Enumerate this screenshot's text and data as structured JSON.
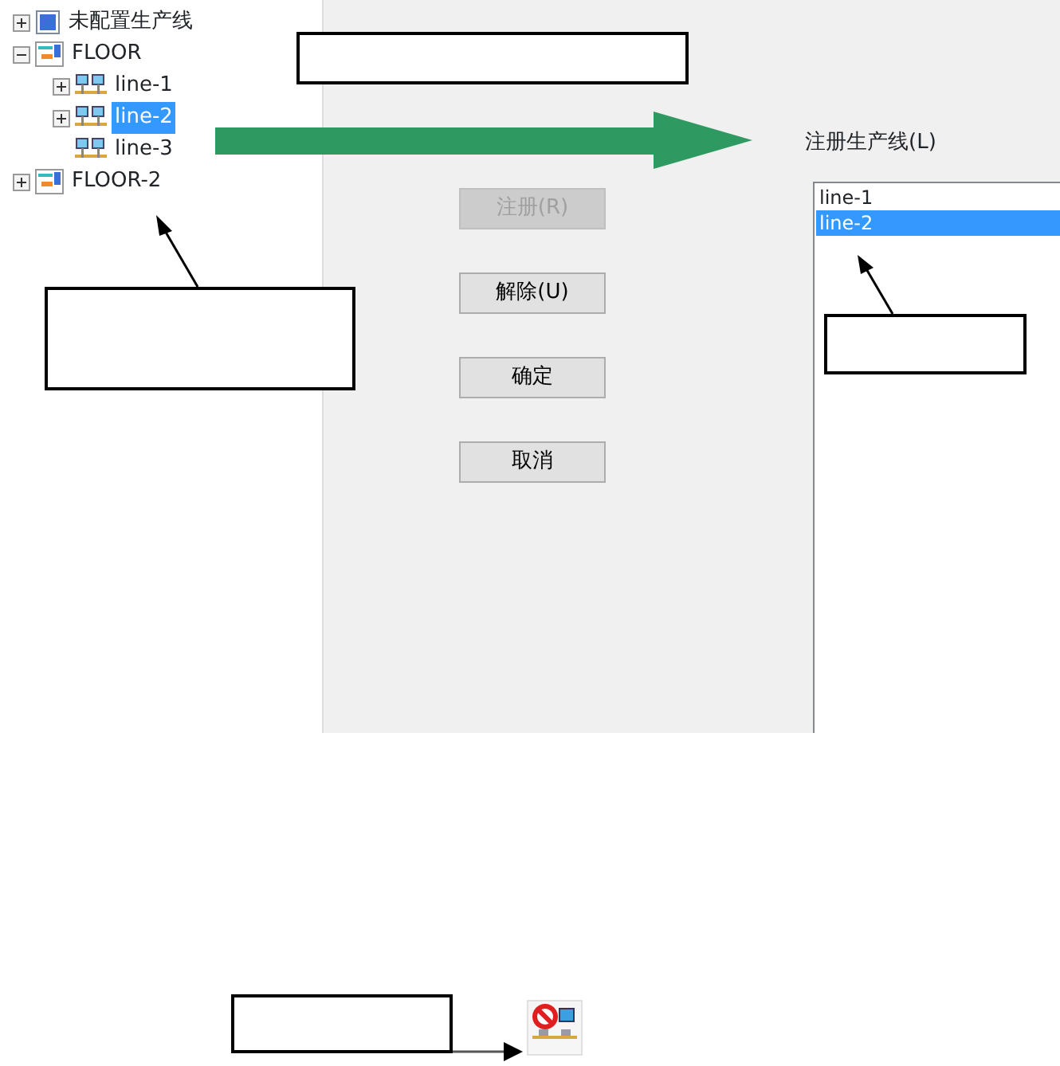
{
  "tree": [
    {
      "label": "未配置生产线",
      "kind": "unassigned",
      "has_children": true,
      "expanded": false,
      "selected": false
    },
    {
      "label": "FLOOR",
      "kind": "floor",
      "has_children": true,
      "expanded": true,
      "selected": false,
      "children": [
        {
          "label": "line-1",
          "kind": "line",
          "has_children": true,
          "expanded": false,
          "selected": false
        },
        {
          "label": "line-2",
          "kind": "line",
          "has_children": true,
          "expanded": false,
          "selected": true
        },
        {
          "label": "line-3",
          "kind": "line",
          "has_children": false,
          "selected": false
        }
      ]
    },
    {
      "label": "FLOOR-2",
      "kind": "floor",
      "has_children": true,
      "expanded": false,
      "selected": false
    }
  ],
  "buttons": [
    {
      "label": "注册(R)",
      "disabled": true
    },
    {
      "label": "解除(U)",
      "disabled": false
    },
    {
      "label": "确定",
      "disabled": false
    },
    {
      "label": "取消",
      "disabled": false
    }
  ],
  "registered": {
    "label": "注册生产线(L)",
    "items": [
      {
        "label": "line-1",
        "selected": false
      },
      {
        "label": "line-2",
        "selected": true
      }
    ]
  }
}
